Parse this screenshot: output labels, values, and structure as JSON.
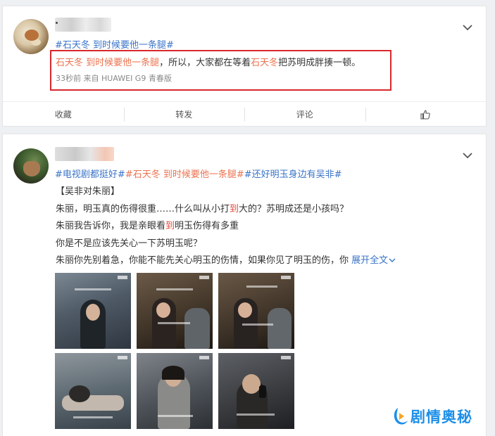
{
  "post1": {
    "tags": "#石天冬 到时候要他一条腿#",
    "text": {
      "topic1": "石天冬 到时候要他一条腿",
      "middle": "，所以，大家都在等着",
      "topic2": "石天冬",
      "end": "把苏明成胖揍一顿。"
    },
    "meta": "33秒前 来自 HUAWEI G9 青春版",
    "actions": [
      "收藏",
      "转发",
      "评论",
      "thumbs-up-icon"
    ]
  },
  "post2": {
    "tags": {
      "tag1": "#电视剧都挺好#",
      "tag2": "#石天冬 到时候要他一条腿#",
      "tag3": "#还好明玉身边有吴非#"
    },
    "lines": {
      "l1": "【吴非对朱丽】",
      "l2a": "朱丽，明玉真的伤得很重……什么叫从小打",
      "l2b": "到",
      "l2c": "大的？苏明成还是小孩吗？",
      "l3a": "朱丽我告诉你，我是亲眼看",
      "l3b": "到",
      "l3c": "明玉伤得有多重",
      "l4": "你是不是应该先关心一下苏明玉呢？",
      "l5": "朱丽你先别着急，你能不能先关心明玉的伤情，如果你见了明玉的伤，你",
      "expand": "展开全文"
    }
  },
  "watermark": "剧情奥秘",
  "colors": {
    "topic": "#eb7350",
    "link": "#3a74c8",
    "highlight_box": "#d9282c",
    "watermark": "#1e8fe8"
  }
}
